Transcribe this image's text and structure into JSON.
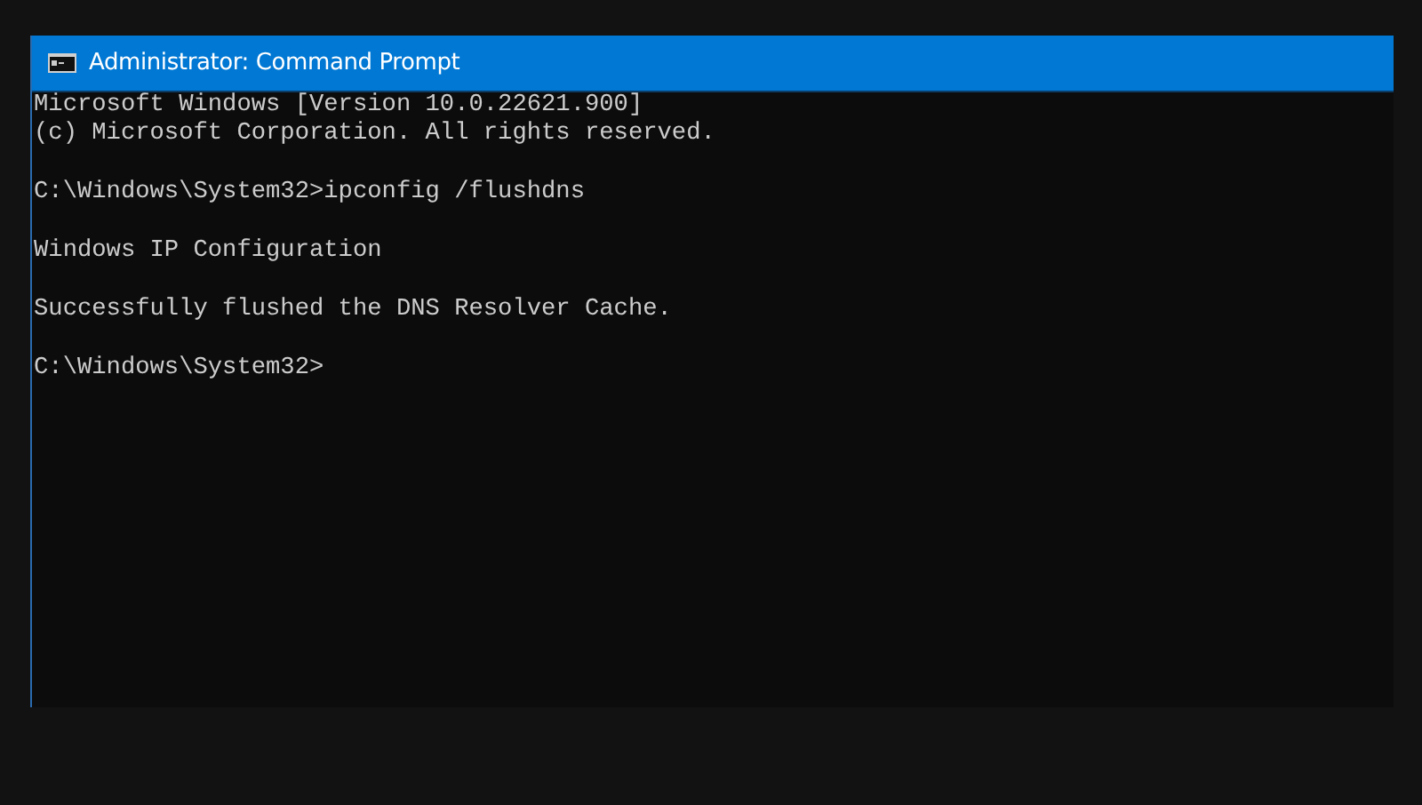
{
  "window": {
    "title": "Administrator: Command Prompt"
  },
  "console": {
    "blocks": [
      [
        "Microsoft Windows [Version 10.0.22621.900]",
        "(c) Microsoft Corporation. All rights reserved."
      ],
      [
        "C:\\Windows\\System32>ipconfig /flushdns"
      ],
      [
        "Windows IP Configuration"
      ],
      [
        "Successfully flushed the DNS Resolver Cache."
      ],
      [
        "C:\\Windows\\System32>"
      ]
    ]
  }
}
